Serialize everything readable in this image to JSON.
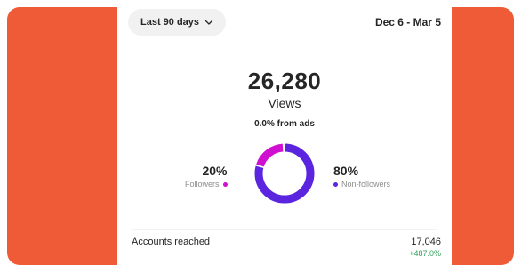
{
  "header": {
    "range_selector": "Last 90 days",
    "date_range": "Dec 6 - Mar 5"
  },
  "summary": {
    "total": "26,280",
    "total_label": "Views",
    "ads_note": "0.0% from ads"
  },
  "breakdown": {
    "followers": {
      "percent": "20%",
      "label": "Followers",
      "share": 0.2,
      "color": "#d10fd1"
    },
    "non_followers": {
      "percent": "80%",
      "label": "Non-followers",
      "share": 0.8,
      "color": "#5b25e0"
    }
  },
  "metrics": {
    "accounts_reached": {
      "label": "Accounts reached",
      "value": "17,046",
      "change": "+487.0%"
    }
  },
  "colors": {
    "background": "#ef5a37",
    "positive": "#32a05f"
  }
}
